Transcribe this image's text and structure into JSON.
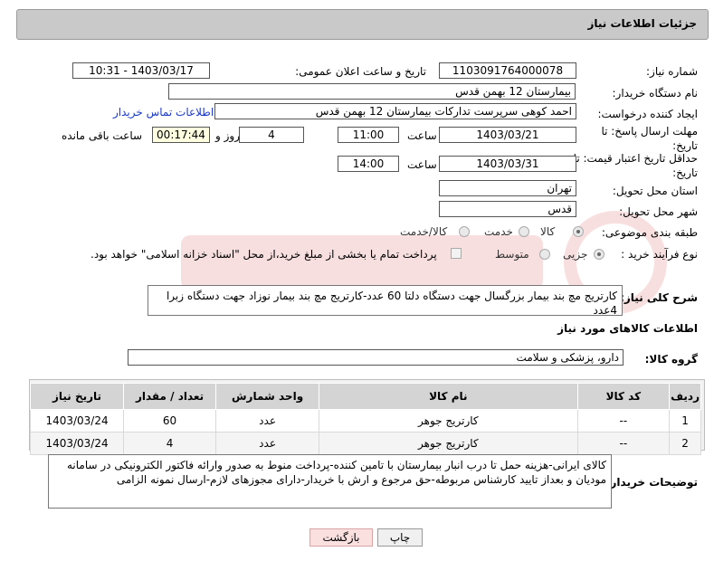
{
  "header": {
    "title": "جزئیات اطلاعات نیاز"
  },
  "fields": {
    "need_number_label": "شماره نیاز:",
    "need_number": "1103091764000078",
    "announce_label": "تاریخ و ساعت اعلان عمومی:",
    "announce_value": "1403/03/17 - 10:31",
    "buyer_org_label": "نام دستگاه خریدار:",
    "buyer_org": "بیمارستان 12 بهمن قدس",
    "creator_label": "ایجاد کننده درخواست:",
    "creator": "احمد کوهی سرپرست تدارکات بیمارستان 12 بهمن قدس",
    "contact_link": "اطلاعات تماس خریدار",
    "deadline_label": "مهلت ارسال پاسخ: تا تاریخ:",
    "deadline_date": "1403/03/21",
    "time_label": "ساعت",
    "deadline_time": "11:00",
    "days_value": "4",
    "days_and_label": "روز و",
    "remaining_time": "00:17:44",
    "remaining_label": "ساعت باقی مانده",
    "validity_label": "حداقل تاریخ اعتبار قیمت: تا تاریخ:",
    "validity_date": "1403/03/31",
    "validity_time_label": "ساعت",
    "validity_time": "14:00",
    "province_label": "استان محل تحویل:",
    "province": "تهران",
    "city_label": "شهر محل تحویل:",
    "city": "قدس",
    "category_label": "طبقه بندی موضوعی:",
    "category_options": [
      "کالا",
      "خدمت",
      "کالا/خدمت"
    ],
    "process_label": "نوع فرآیند خرید :",
    "process_options": [
      "جزیی",
      "متوسط"
    ],
    "payment_note": "پرداخت تمام یا بخشی از مبلغ خرید،از محل \"اسناد خزانه اسلامی\" خواهد بود."
  },
  "description": {
    "label": "شرح کلی نیاز:",
    "text": "کارتریج مچ بند بیمار بزرگسال جهت دستگاه دلتا 60 عدد-کارتریج مچ بند بیمار نوزاد جهت دستگاه زبرا 4عدد"
  },
  "goods_section": {
    "title": "اطلاعات کالاهای مورد نیاز",
    "group_label": "گروه کالا:",
    "group_value": "دارو، پزشکی و سلامت"
  },
  "table": {
    "headers": [
      "ردیف",
      "کد کالا",
      "نام کالا",
      "واحد شمارش",
      "تعداد / مقدار",
      "تاریخ نیاز"
    ],
    "rows": [
      [
        "1",
        "--",
        "کارتریج جوهر",
        "عدد",
        "60",
        "1403/03/24"
      ],
      [
        "2",
        "--",
        "کارتریج جوهر",
        "عدد",
        "4",
        "1403/03/24"
      ]
    ]
  },
  "buyer_notes": {
    "label": "توضیحات خریدار:",
    "text": "کالای ایرانی-هزینه حمل تا درب  انبار بیمارستان با تامین کننده-پرداخت منوط به صدور وارائه فاکتور الکترونیکی  در سامانه مودیان و بعداز تایید کارشناس مربوطه-حق مرجوع و ارش با خریدار-دارای مجوزهای لازم-ارسال نمونه الزامی"
  },
  "buttons": {
    "print": "چاپ",
    "back": "بازگشت"
  },
  "colors": {
    "link": "#1a39c8",
    "header_bg": "#c9c9c9",
    "back_bg": "#fbe0e0"
  }
}
